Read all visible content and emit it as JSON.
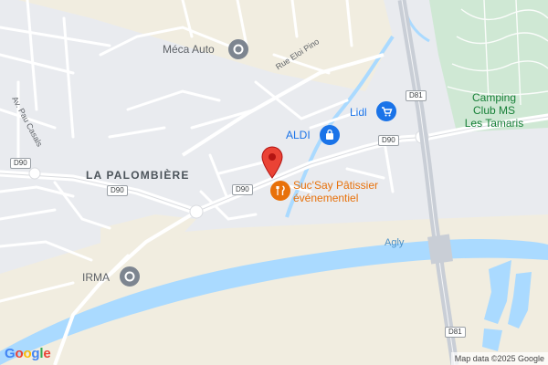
{
  "map": {
    "places": {
      "la_palombiere": "LA PALOMBIÈRE"
    },
    "pois": {
      "meca_auto": "Méca Auto",
      "aldi": "ALDI",
      "lidl": "Lidl",
      "irma": "IRMA",
      "sucsay_line1": "Suc'Say Pâtissier",
      "sucsay_line2": "événementiel",
      "camping_line1": "Camping",
      "camping_line2": "Club MS",
      "camping_line3": "Les Tamaris"
    },
    "streets": {
      "rue_eloi_pino": "Rue Eloi Pino",
      "av_pau_casals": "Av. Pau Casals"
    },
    "road_shields": {
      "d90_left": "D90",
      "d90_mid": "D90",
      "d90_center": "D90",
      "d90_right": "D90",
      "d81_top": "D81",
      "d81_bottom": "D81"
    },
    "water": {
      "river": "Agly"
    },
    "branding": {
      "logo_letters": [
        "G",
        "o",
        "o",
        "g",
        "l",
        "e"
      ],
      "logo_colors": [
        "#4285F4",
        "#EA4335",
        "#FBBC05",
        "#4285F4",
        "#34A853",
        "#EA4335"
      ]
    },
    "attribution": "Map data ©2025 Google",
    "colors": {
      "land": "#e9ebef",
      "fields": "#f1ede0",
      "green_area": "#cfe8d4",
      "water": "#aadaff",
      "road": "#ffffff",
      "highway": "#c9ced6",
      "marker": "#ea4335",
      "poi_orange": "#e8710a",
      "poi_blue": "#1a73e8",
      "poi_green": "#188038"
    }
  }
}
